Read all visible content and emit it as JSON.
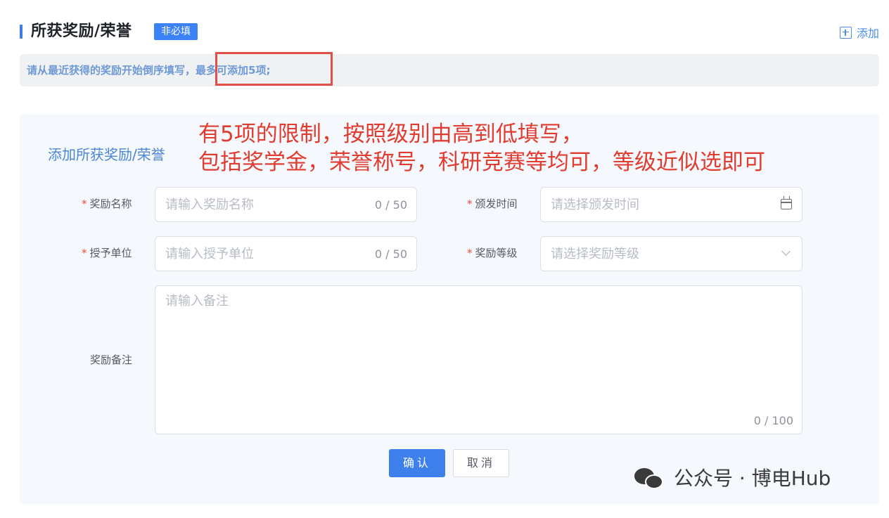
{
  "section": {
    "title": "所获奖励/荣誉",
    "badge": "非必填",
    "add_label": "添加"
  },
  "notice": {
    "text": "请从最近获得的奖励开始倒序填写，最多可添加5项;"
  },
  "panel": {
    "title": "添加所获奖励/荣誉",
    "annotation_line1": "有5项的限制，按照级别由高到低填写，",
    "annotation_line2": "包括奖学金，荣誉称号，科研竞赛等均可，等级近似选即可"
  },
  "form": {
    "award_name": {
      "required_mark": "*",
      "label": "奖励名称",
      "placeholder": "请输入奖励名称",
      "count": "0 / 50"
    },
    "issue_date": {
      "required_mark": "*",
      "label": "颁发时间",
      "placeholder": "请选择颁发时间",
      "icon": "calendar-icon"
    },
    "issuer": {
      "required_mark": "*",
      "label": "授予单位",
      "placeholder": "请输入授予单位",
      "count": "0 / 50"
    },
    "award_level": {
      "required_mark": "*",
      "label": "奖励等级",
      "placeholder": "请选择奖励等级",
      "icon": "chevron-down-icon"
    },
    "remarks": {
      "label": "奖励备注",
      "placeholder": "请输入备注",
      "count": "0 / 100"
    }
  },
  "buttons": {
    "confirm": "确认",
    "cancel": "取消"
  },
  "watermark": {
    "text": "公众号 · 博电Hub",
    "icon": "wechat-icon"
  },
  "colors": {
    "accent": "#3d80ec",
    "annotation": "#e03c2f",
    "required": "#f0493c"
  }
}
